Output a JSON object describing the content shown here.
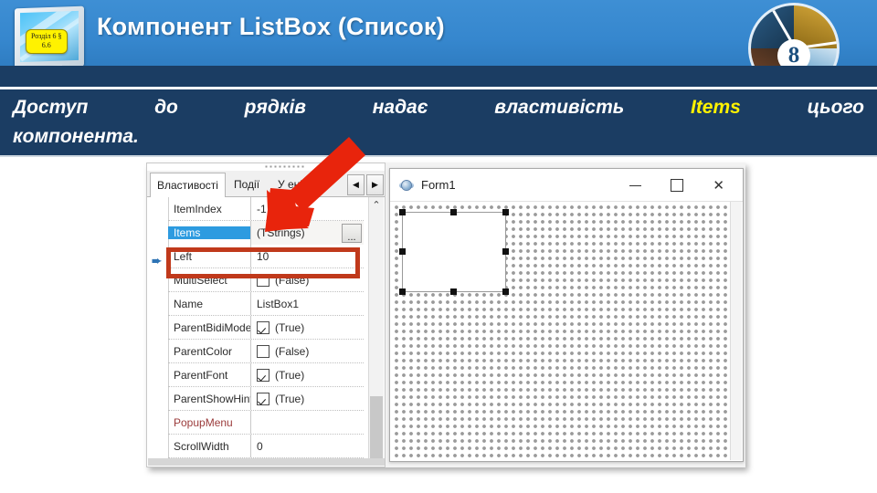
{
  "header": {
    "title": "Компонент ListBox (Список)",
    "section_badge": "Розділ 6 §\n6.6",
    "chapter_number": "8",
    "accent_blue": "#3687CE",
    "navy": "#1B3D63",
    "badge_yellow": "#FFF200"
  },
  "statement": {
    "words": [
      "Доступ",
      "до",
      "рядків",
      "надає",
      "властивість"
    ],
    "highlight": "Items",
    "tail": "цього",
    "line2": "компонента.",
    "highlight_color": "#FFF200"
  },
  "object_inspector": {
    "tabs": [
      {
        "label": "Властивості",
        "active": true
      },
      {
        "label": "Події",
        "active": false
      },
      {
        "label": "У          ені",
        "active": false
      }
    ],
    "nav_prev": "◀",
    "nav_next": "▶",
    "scroll_up_icon": "⌃",
    "selected_property": "Items",
    "rows": [
      {
        "name": "ItemIndex",
        "value": "-1",
        "type": "text"
      },
      {
        "name": "Items",
        "value": "(TStrings)",
        "type": "ellipsis",
        "selected": true,
        "button": "..."
      },
      {
        "name": "Left",
        "value": "10",
        "type": "text"
      },
      {
        "name": "MultiSelect",
        "value": "(False)",
        "type": "checkbox",
        "checked": false
      },
      {
        "name": "Name",
        "value": "ListBox1",
        "type": "text"
      },
      {
        "name": "ParentBidiMode",
        "value": "(True)",
        "type": "checkbox",
        "checked": true
      },
      {
        "name": "ParentColor",
        "value": "(False)",
        "type": "checkbox",
        "checked": false
      },
      {
        "name": "ParentFont",
        "value": "(True)",
        "type": "checkbox",
        "checked": true
      },
      {
        "name": "ParentShowHint",
        "value": "(True)",
        "type": "checkbox",
        "checked": true
      },
      {
        "name": "PopupMenu",
        "value": "",
        "type": "text",
        "name_color": "red"
      },
      {
        "name": "ScrollWidth",
        "value": "0",
        "type": "text"
      }
    ],
    "highlight_color": "#C0391B"
  },
  "form_designer": {
    "window_title": "Form1",
    "minimize_label": "—",
    "maximize_label": "□",
    "close_label": "✕",
    "selected_control": "ListBox1"
  },
  "annotation": {
    "arrow_color": "#E8240C",
    "points_to": "Items"
  }
}
